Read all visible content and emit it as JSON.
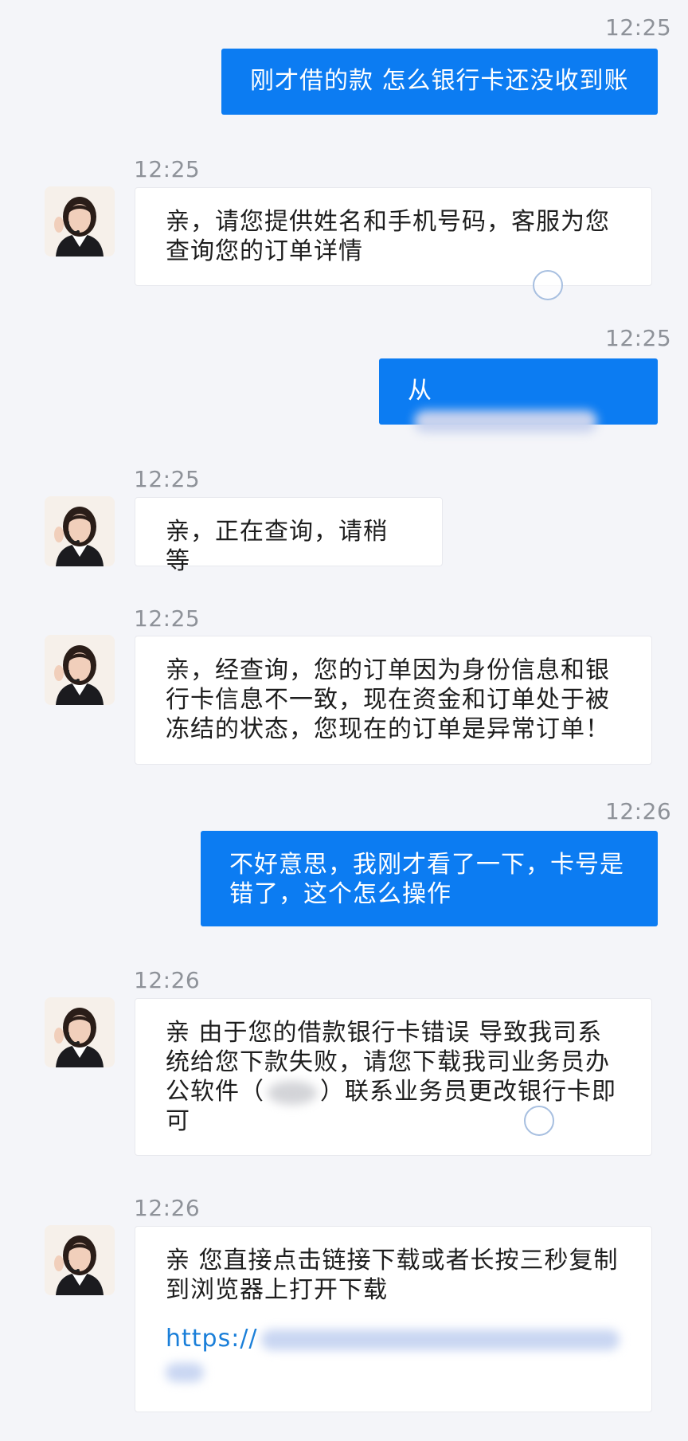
{
  "messages": [
    {
      "time": "12:25",
      "text": "刚才借的款 怎么银行卡还没收到账"
    },
    {
      "time": "12:25",
      "lines": [
        "亲，请您提供姓名和手机号码，客服为您",
        "查询您的订单详情"
      ]
    },
    {
      "time": "12:25",
      "prefix": "从"
    },
    {
      "time": "12:25",
      "text": "亲，正在查询，请稍等"
    },
    {
      "time": "12:25",
      "lines": [
        "亲，经查询，您的订单因为身份信息和银",
        "行卡信息不一致，现在资金和订单处于被",
        "冻结的状态，您现在的订单是异常订单！"
      ]
    },
    {
      "time": "12:26",
      "lines": [
        "不好意思，我刚才看了一下，卡号是",
        "错了，这个怎么操作"
      ]
    },
    {
      "time": "12:26",
      "line1": "亲 由于您的借款银行卡错误 导致我司系",
      "line2": "统给您下款失败，请您下载我司业务员办",
      "line3_a": "公软件（",
      "line3_b": "）联系业务员更改银行卡即",
      "line4": "可"
    },
    {
      "time": "12:26",
      "lines": [
        "亲 您直接点击链接下载或者长按三秒复制",
        "到浏览器上打开下载"
      ],
      "link_prefix": "https://"
    }
  ],
  "colors": {
    "outgoing": "#0c7cf2",
    "incoming": "#ffffff",
    "background": "#f4f5f9",
    "link": "#1a7fd9"
  }
}
